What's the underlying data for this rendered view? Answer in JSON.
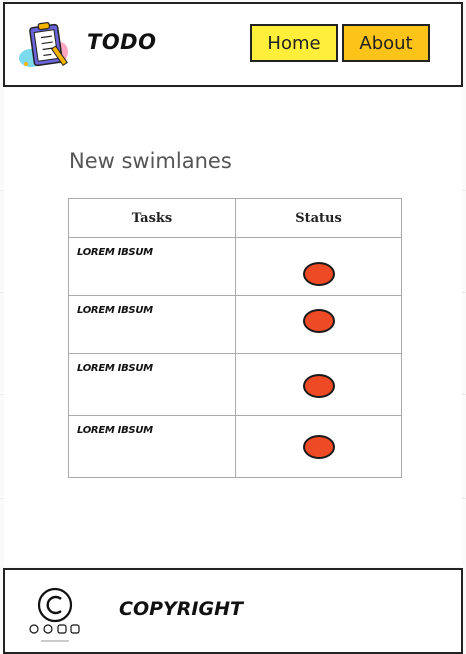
{
  "header": {
    "brand": "TODO",
    "logo_icon": "clipboard-checklist-icon",
    "nav": [
      {
        "label": "Home",
        "color": "#ffef3a"
      },
      {
        "label": "About",
        "color": "#fcc419"
      }
    ]
  },
  "main": {
    "title": "New swimlanes",
    "table": {
      "headers": [
        "Tasks",
        "Status"
      ],
      "rows": [
        {
          "task": "LOREM IBSUM",
          "status_color": "#ee4a26"
        },
        {
          "task": "LOREM IBSUM",
          "status_color": "#ee4a26"
        },
        {
          "task": "LOREM IBSUM",
          "status_color": "#ee4a26"
        },
        {
          "task": "LOREM IBSUM",
          "status_color": "#ee4a26"
        }
      ]
    }
  },
  "footer": {
    "copyright": "COPYRIGHT",
    "icon": "copyright-icon",
    "social_icons": [
      "creative-commons-icon",
      "attribution-icon",
      "noncommercial-icon",
      "noderivs-icon"
    ]
  }
}
